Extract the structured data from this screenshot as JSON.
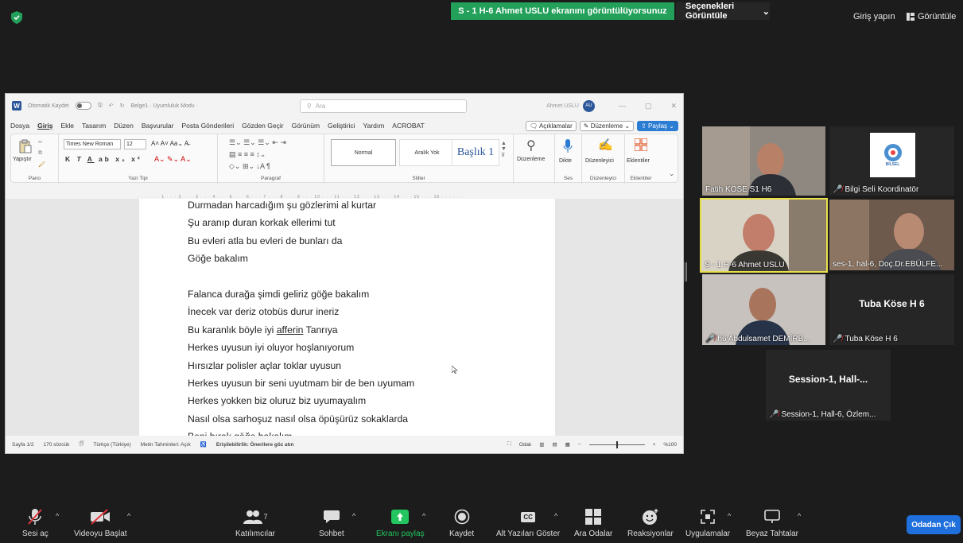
{
  "top": {
    "share_banner": "S - 1 H-6 Ahmet USLU ekranını görüntülüyorsunuz",
    "view_options": "Seçenekleri Görüntüle",
    "sign_in": "Giriş yapın",
    "view": "Görüntüle"
  },
  "word": {
    "autosave": "Otomatik Kaydet",
    "doc_title": "Belge1  ·  Uyumluluk Modu  ·",
    "search": "Ara",
    "user_name": "Ahmet USLU",
    "user_initials": "AU",
    "menu": [
      "Dosya",
      "Giriş",
      "Ekle",
      "Tasarım",
      "Düzen",
      "Başvurular",
      "Posta Gönderileri",
      "Gözden Geçir",
      "Görünüm",
      "Geliştirici",
      "Yardım",
      "ACROBAT"
    ],
    "menu_right": {
      "comments": "Açıklamalar",
      "editing": "Düzenleme",
      "share": "Paylaş"
    },
    "ribbon": {
      "paste": "Yapıştır",
      "clipboard": "Pano",
      "font_name": "Times New Roman",
      "font_size": "12",
      "font_group": "Yazı Tipi",
      "paragraph_group": "Paragraf",
      "styles": [
        "Normal",
        "Aralık Yok",
        "Başlık 1"
      ],
      "styles_group": "Stiller",
      "editing_btn": "Düzenleme",
      "dictate_btn": "Dikte",
      "voice_group": "Ses",
      "editor_btn": "Düzenleyici",
      "editor_group": "Düzenleyici",
      "addins_btn": "Eklentiler",
      "addins_group": "Eklentiler"
    },
    "poem_lines": [
      "Durmadan harcadığım şu gözlerimi al kurtar",
      "Şu aranıp duran korkak ellerimi tut",
      "Bu evleri atla bu evleri de bunları da",
      "Göğe bakalım",
      "",
      "Falanca durağa şimdi geliriz göğe bakalım",
      "İnecek var deriz otobüs durur ineriz",
      "Bu karanlık böyle iyi",
      "afferin",
      "Tanrıya",
      "Herkes uyusun iyi oluyor hoşlanıyorum",
      "Hırsızlar polisler açlar toklar uyusun",
      "Herkes uyusun bir seni uyutmam bir de ben uyumam",
      "Herkes yokken biz oluruz biz uyumayalım",
      "Nasıl olsa sarhoşuz nasıl olsa öpüşürüz sokaklarda",
      "Beni bırak göğe bakalım"
    ],
    "status": {
      "page": "Sayfa 1/2",
      "words": "170 sözcük",
      "language": "Türkçe (Türkiye)",
      "predictions": "Metin Tahminleri: Açık",
      "accessibility": "Erişilebilirlik: Önerilere göz atın",
      "focus": "Odak",
      "zoom": "%100"
    }
  },
  "participants": [
    {
      "name": "Fatih KÖSE S1 H6",
      "muted": false
    },
    {
      "name": "Bilgi Seli Koordinatör",
      "muted": true,
      "logo": "BİLSEL"
    },
    {
      "name": "S - 1 H-6 Ahmet USLU",
      "muted": false,
      "active": true
    },
    {
      "name": "ses-1, hal-6, Doç.Dr.EBÜLFE...",
      "muted": false
    },
    {
      "name": "h6 Abdulsamet DEMİRB...",
      "muted": true
    },
    {
      "name": "Tuba Köse H 6",
      "muted": true,
      "display": "Tuba Köse H 6"
    },
    {
      "name": "Session-1, Hall-6, Özlem...",
      "muted": true,
      "display": "Session-1,  Hall-..."
    }
  ],
  "toolbar": {
    "audio": "Sesi aç",
    "video": "Videoyu Başlat",
    "participants": "Katılımcılar",
    "participants_count": "7",
    "chat": "Sohbet",
    "share": "Ekranı paylaş",
    "record": "Kaydet",
    "captions": "Alt Yazıları Göster",
    "captions_icon": "CC",
    "breakout": "Ara Odalar",
    "reactions": "Reaksiyonlar",
    "apps": "Uygulamalar",
    "whiteboard": "Beyaz Tahtalar",
    "leave": "Odadan Çık"
  },
  "colors": {
    "banner_green": "#23a05a",
    "active_speaker": "#e8e04b",
    "leave_blue": "#1f6fdc",
    "muted_red": "#e0363c",
    "share_green": "#22c55e"
  }
}
